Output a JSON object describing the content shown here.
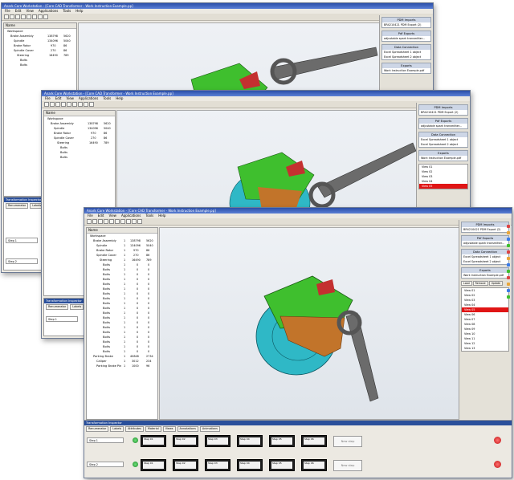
{
  "app": {
    "window_title": "Anark Core Workstation - [Core CAD Transformer - Work Instruction Example.pp]",
    "menu": [
      "File",
      "Edit",
      "View",
      "Applications",
      "Tools",
      "Help"
    ]
  },
  "tree": {
    "header": "Name",
    "root": "Workspace",
    "items": [
      {
        "label": "Brake Assembly",
        "c1": "1",
        "c2": "138798",
        "c3": "5620"
      },
      {
        "label": "Spindle",
        "c1": "1",
        "c2": "134096",
        "c3": "5040"
      },
      {
        "label": "Brake Rotor",
        "c1": "1",
        "c2": "970",
        "c3": "86"
      },
      {
        "label": "Spindle Cover",
        "c1": "1",
        "c2": "270",
        "c3": "86"
      },
      {
        "label": "Steering",
        "c1": "1",
        "c2": "16490",
        "c3": "789"
      },
      {
        "label": "Bolts",
        "c1": "1",
        "c2": "0",
        "c3": "0"
      },
      {
        "label": "Parking Brake",
        "c1": "1",
        "c2": "40848",
        "c3": "2734"
      },
      {
        "label": "Caliper",
        "c1": "1",
        "c2": "3012",
        "c3": "234"
      },
      {
        "label": "Parking Brake Pin",
        "c1": "1",
        "c2": "1000",
        "c3": "96"
      }
    ]
  },
  "right_panel": {
    "pdm_header": "PDM Imports",
    "pdm_item": "BR4210421 PDM Export (2)",
    "pdf_header": "Pdf Exports",
    "pdf_item": "adjustable spark transmitter...",
    "data_header": "Data Connection",
    "data_items": [
      "Excel Spreadsheet 1 object",
      "Excel Spreadsheet 2 object"
    ],
    "exports_header": "Exports",
    "export_item": "Work Instruction Example.pdf",
    "buttons": [
      "Load",
      "Remove",
      "Update"
    ],
    "views": [
      "View 01",
      "View 02",
      "View 03",
      "View 04",
      "View 05",
      "View 06",
      "View 07",
      "View 08",
      "View 09",
      "View 10",
      "View 11",
      "View 12",
      "View 13"
    ],
    "selected_view_index": 4
  },
  "transformation": {
    "title": "Transformation Inspector",
    "tabs": [
      "Renumerator",
      "Labels",
      "Attributes",
      "Material",
      "Views",
      "Annotations",
      "Animations"
    ],
    "row_labels": [
      "Step 1",
      "Step 2"
    ],
    "steps": [
      "Step 01",
      "Step 02",
      "Step 03",
      "Step 04",
      "Step 05",
      "Step 06"
    ],
    "new_step": "New step"
  },
  "colors": {
    "caliper_green": "#3fbf2e",
    "rotor_cyan": "#2fb8c6",
    "bracket_orange": "#c2742a",
    "wrench_gray": "#6b6b6b",
    "selection_red": "#e01515"
  }
}
